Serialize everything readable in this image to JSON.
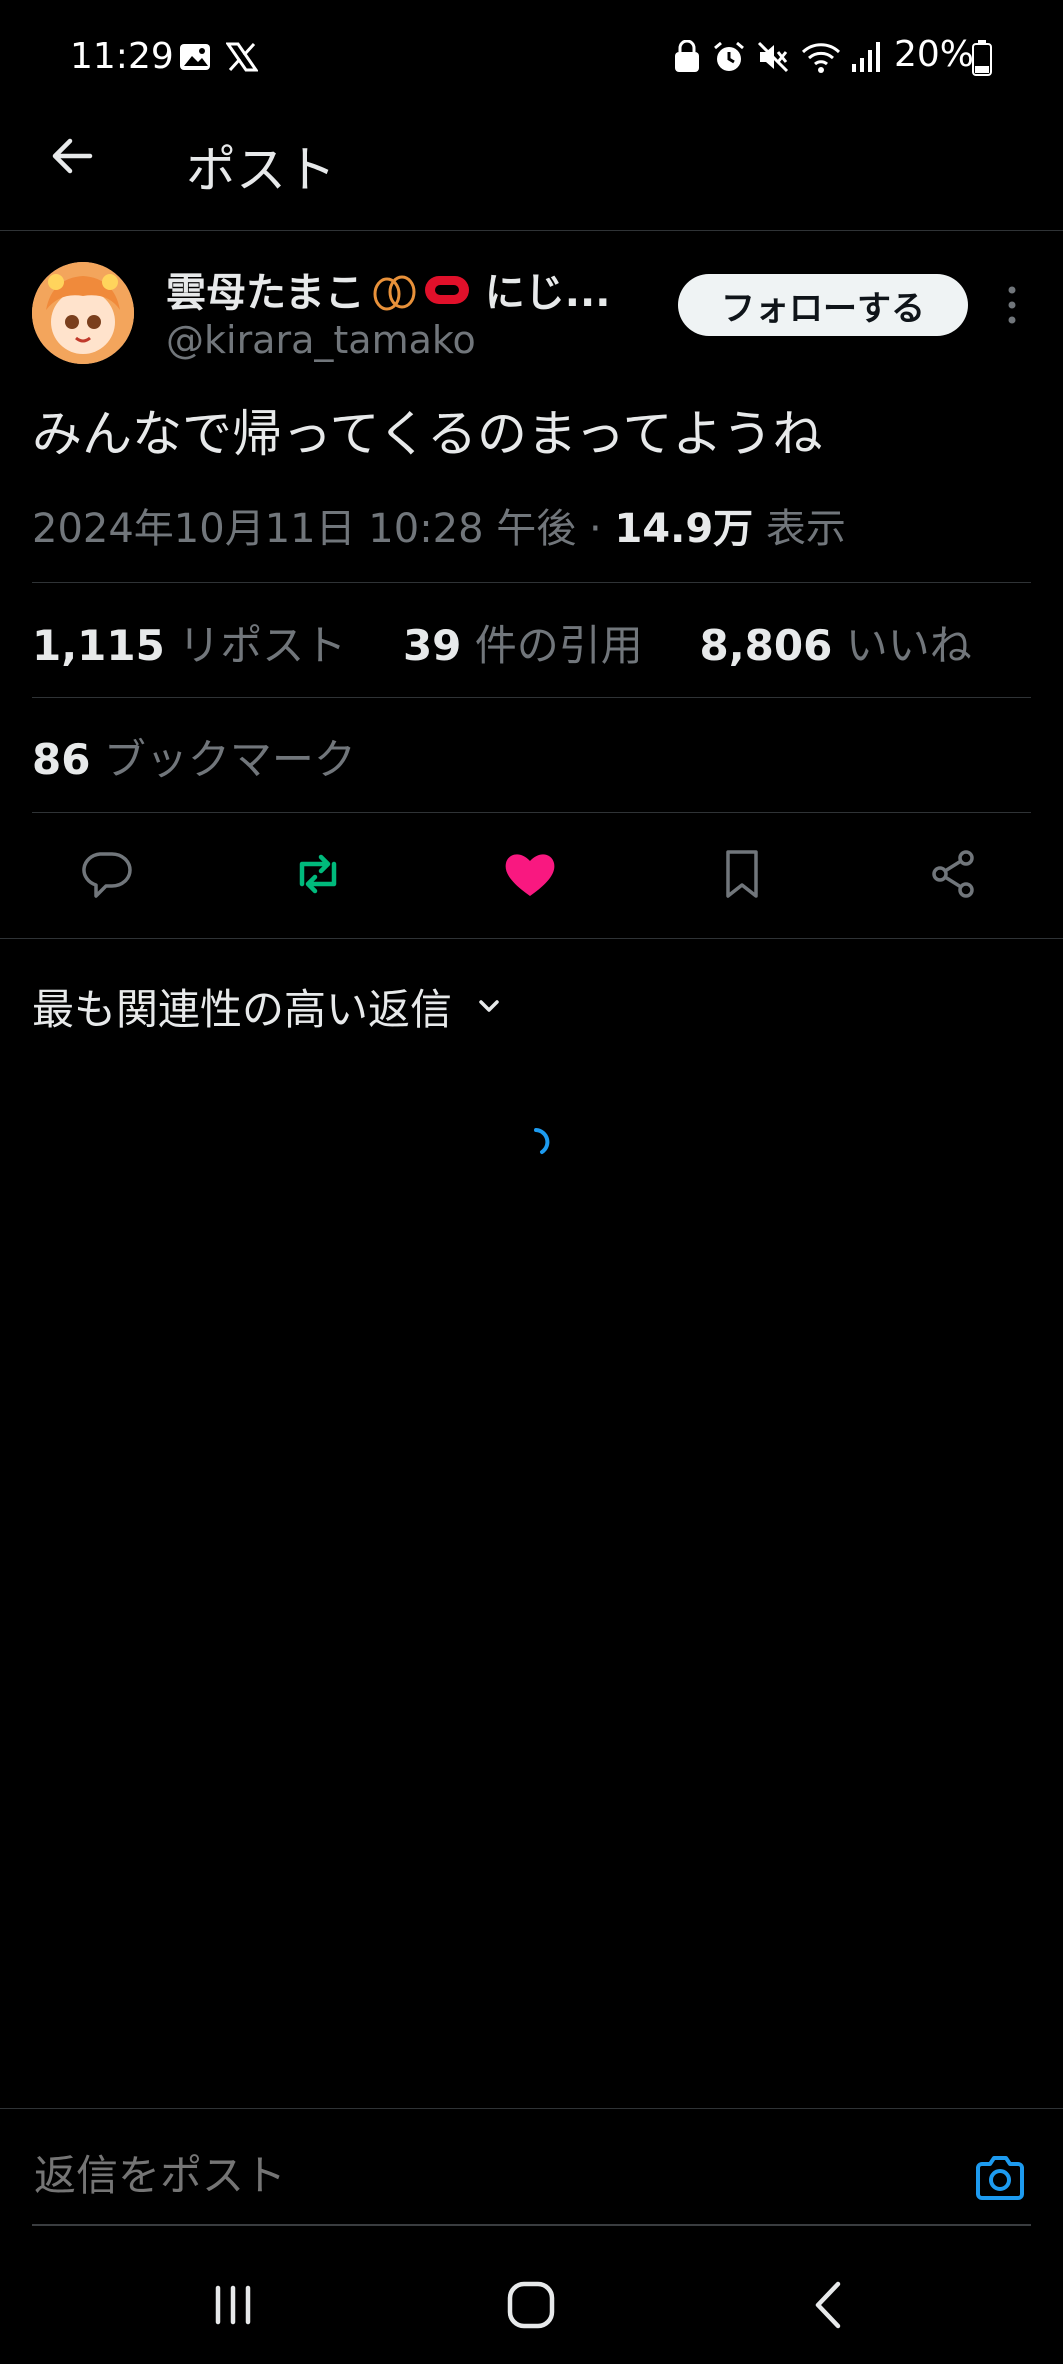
{
  "status_bar": {
    "time": "11:29",
    "battery": "20%"
  },
  "header": {
    "title": "ポスト"
  },
  "author": {
    "name": "雲母たまこ",
    "name_suffix": "にじ...",
    "handle": "@kirara_tamako",
    "follow_label": "フォローする"
  },
  "tweet": {
    "text": "みんなで帰ってくるのまってようね",
    "date": "2024年10月11日 10:28 午後",
    "separator": "·",
    "views_count": "14.9万",
    "views_label": "表示"
  },
  "stats": {
    "reposts_count": "1,115",
    "reposts_label": "リポスト",
    "quotes_count": "39",
    "quotes_label": "件の引用",
    "likes_count": "8,806",
    "likes_label": "いいね",
    "bookmarks_count": "86",
    "bookmarks_label": "ブックマーク"
  },
  "actions": [
    "reply-icon",
    "repost-icon",
    "like-icon",
    "bookmark-icon",
    "share-icon"
  ],
  "colors": {
    "repost": "#00ba7c",
    "like": "#f91880",
    "accent": "#1d9bf0"
  },
  "replies": {
    "sort_label": "最も関連性の高い返信"
  },
  "reply_bar": {
    "placeholder": "返信をポスト"
  }
}
